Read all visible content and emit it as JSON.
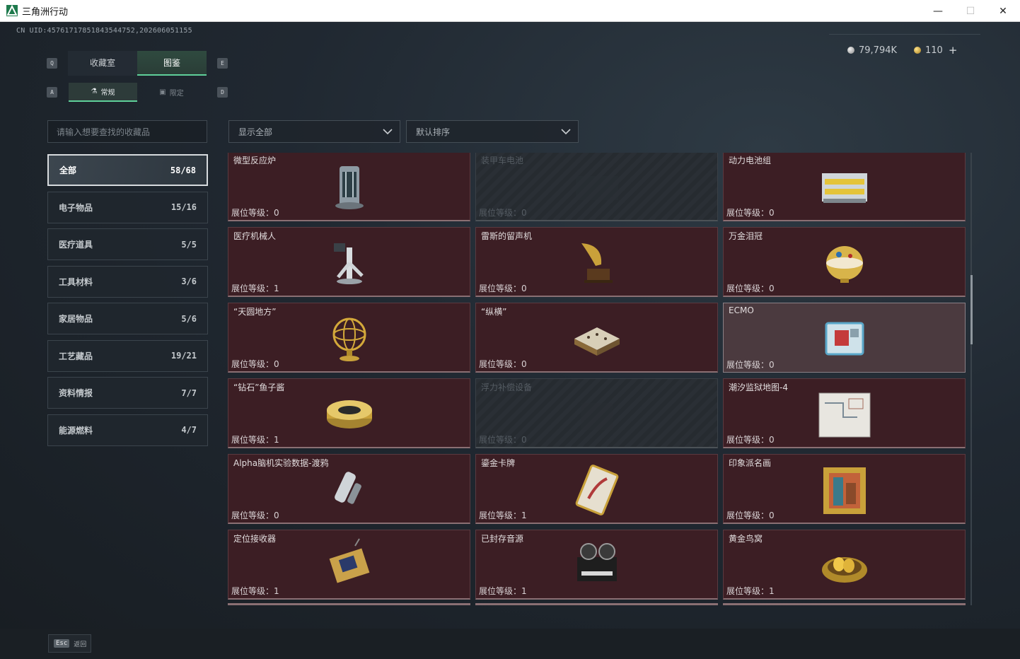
{
  "window": {
    "title": "三角洲行动",
    "minimize": "—",
    "maximize": "☐",
    "close": "✕"
  },
  "uid": "CN UID:4576171785184354475​2,20260605​1155",
  "currency": {
    "silver": "79,794K",
    "gold": "110",
    "plus": "+"
  },
  "keys": {
    "q": "Q",
    "e": "E",
    "a": "A",
    "d": "D"
  },
  "main_tabs": [
    "收藏室",
    "图鉴"
  ],
  "sub_tabs": [
    "常规",
    "限定"
  ],
  "search": {
    "placeholder": "请输入想要查找的收藏品"
  },
  "filters": {
    "show": "显示全部",
    "sort": "默认排序"
  },
  "categories": [
    {
      "name": "全部",
      "count": "58/68"
    },
    {
      "name": "电子物品",
      "count": "15/16"
    },
    {
      "name": "医疗道具",
      "count": "5/5"
    },
    {
      "name": "工具材料",
      "count": "3/6"
    },
    {
      "name": "家居物品",
      "count": "5/6"
    },
    {
      "name": "工艺藏品",
      "count": "19/21"
    },
    {
      "name": "资料情报",
      "count": "7/7"
    },
    {
      "name": "能源燃料",
      "count": "4/7"
    }
  ],
  "level_label": "展位等级：",
  "items": [
    {
      "name": "微型反应炉",
      "level": "0",
      "icon": "reactor-icon",
      "state": "owned"
    },
    {
      "name": "装甲车电池",
      "level": "0",
      "icon": "battery-icon",
      "state": "locked"
    },
    {
      "name": "动力电池组",
      "level": "0",
      "icon": "battery-pack-icon",
      "state": "owned"
    },
    {
      "name": "医疗机械人",
      "level": "1",
      "icon": "medical-robot-icon",
      "state": "owned"
    },
    {
      "name": "雷斯的留声机",
      "level": "0",
      "icon": "gramophone-icon",
      "state": "owned"
    },
    {
      "name": "万金泪冠",
      "level": "0",
      "icon": "jeweled-egg-icon",
      "state": "owned"
    },
    {
      "name": "“天圆地方”",
      "level": "0",
      "icon": "armillary-sphere-icon",
      "state": "owned"
    },
    {
      "name": "“纵横”",
      "level": "0",
      "icon": "chessboard-icon",
      "state": "owned"
    },
    {
      "name": "ECMO",
      "level": "0",
      "icon": "ecmo-machine-icon",
      "state": "highlight"
    },
    {
      "name": "“钻石”鱼子酱",
      "level": "1",
      "icon": "caviar-tin-icon",
      "state": "owned"
    },
    {
      "name": "浮力补偿设备",
      "level": "0",
      "icon": "buoyancy-device-icon",
      "state": "locked"
    },
    {
      "name": "潮汐监狱地图-4",
      "level": "0",
      "icon": "map-icon",
      "state": "owned"
    },
    {
      "name": "Alpha脑机实验数据-渡鸦",
      "level": "0",
      "icon": "data-canister-icon",
      "state": "owned"
    },
    {
      "name": "鎏金卡牌",
      "level": "1",
      "icon": "gilded-card-icon",
      "state": "owned"
    },
    {
      "name": "印象派名画",
      "level": "0",
      "icon": "painting-icon",
      "state": "owned"
    },
    {
      "name": "定位接收器",
      "level": "1",
      "icon": "receiver-icon",
      "state": "owned"
    },
    {
      "name": "已封存音源",
      "level": "1",
      "icon": "tape-recorder-icon",
      "state": "owned"
    },
    {
      "name": "黄金鸟窝",
      "level": "1",
      "icon": "golden-nest-icon",
      "state": "owned"
    }
  ],
  "footer": {
    "esc_key": "Esc",
    "esc_label": "返回"
  }
}
